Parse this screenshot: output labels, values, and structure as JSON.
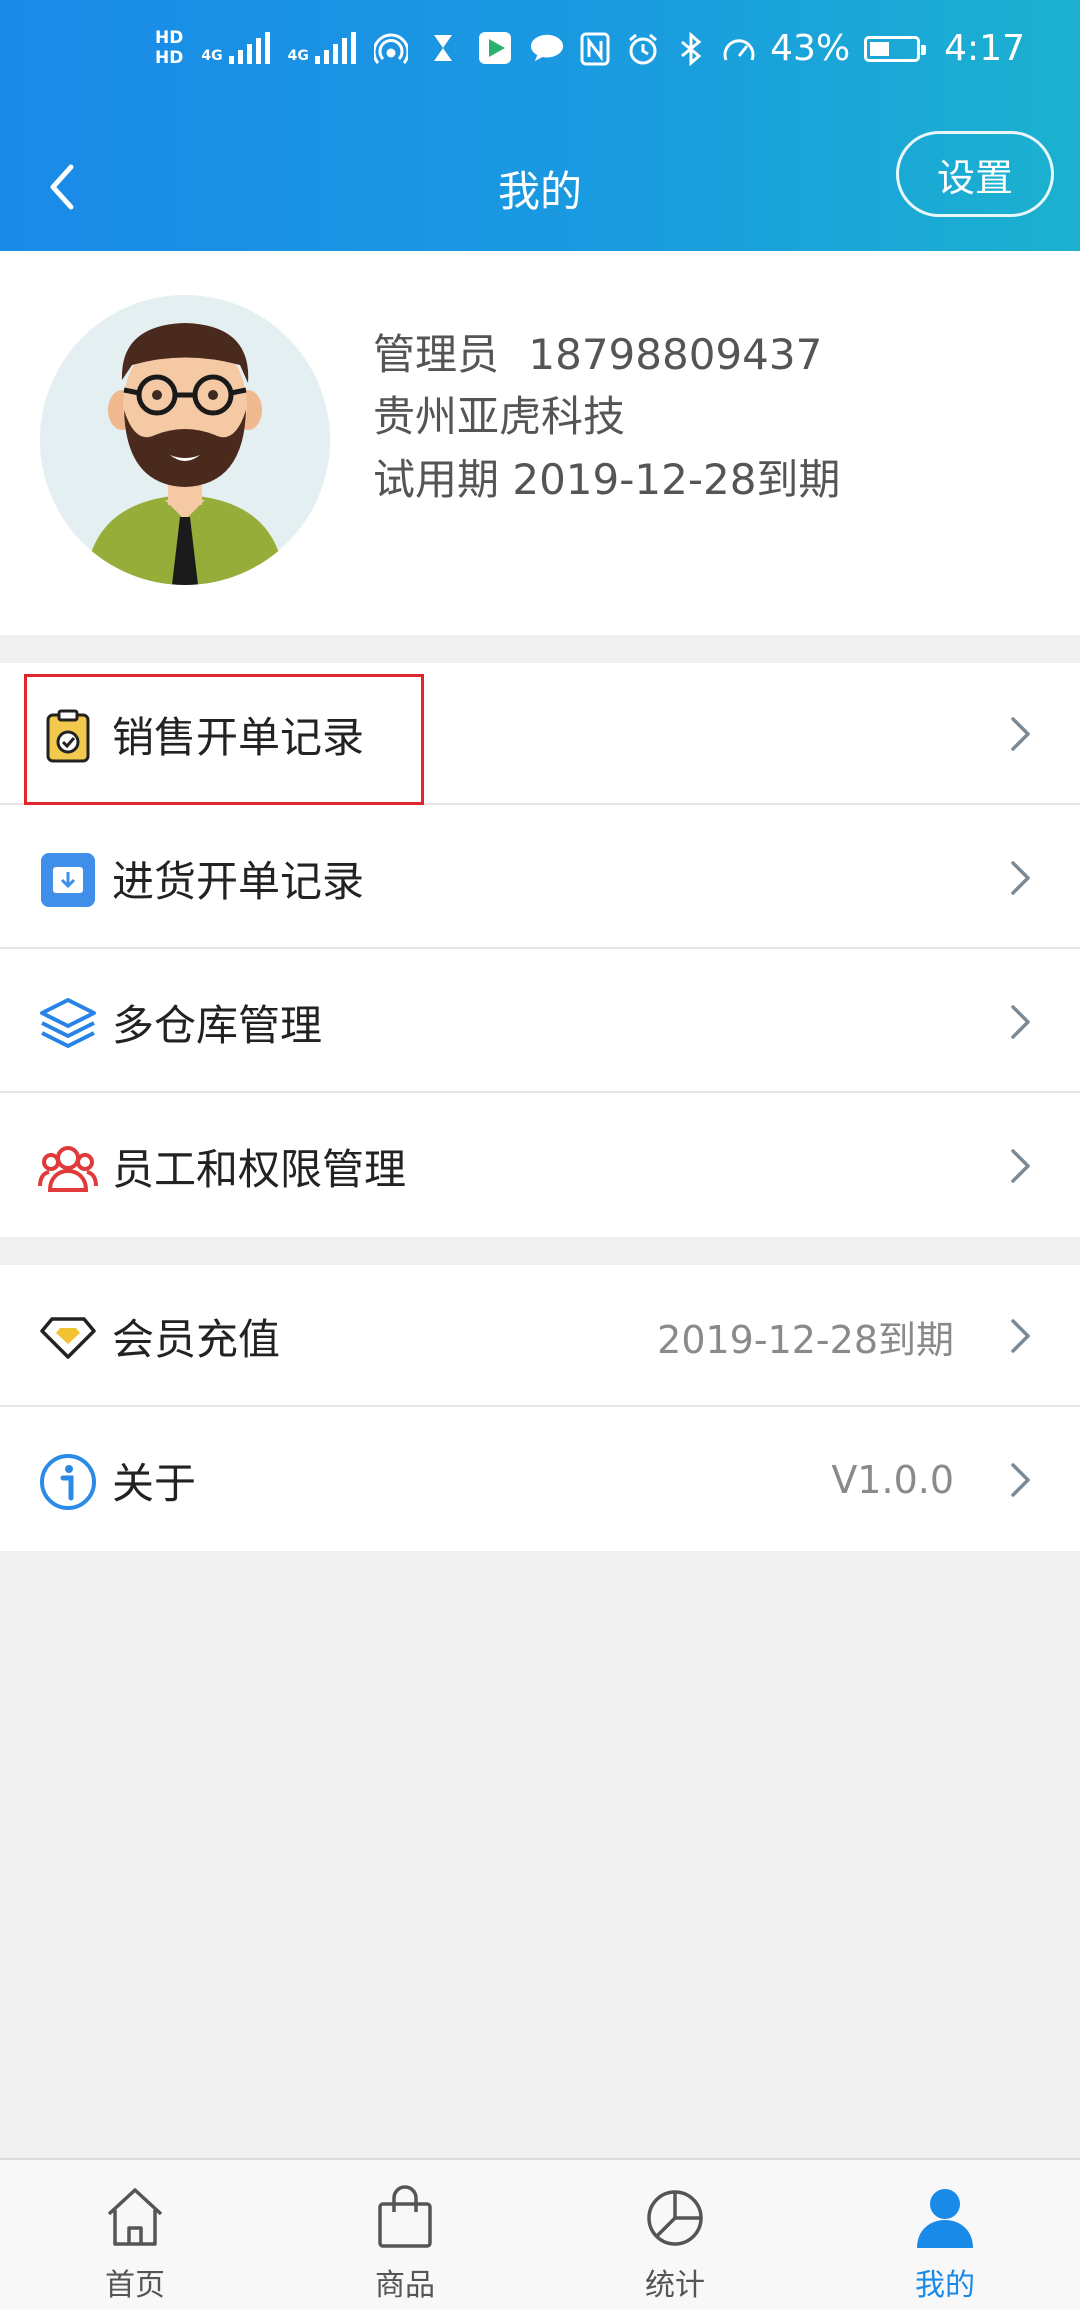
{
  "status_bar": {
    "hd1": "HD",
    "hd2": "HD",
    "net1": "4G",
    "net2": "4G",
    "battery_pct": "43%",
    "battery_level": 0.43,
    "time": "4:17",
    "icons": [
      "hotspot-icon",
      "hourglass-icon",
      "video-app-icon",
      "chat-icon",
      "nfc-icon",
      "alarm-icon",
      "bluetooth-icon",
      "speed-icon",
      "battery-icon"
    ]
  },
  "nav": {
    "title": "我的",
    "settings_label": "设置"
  },
  "profile": {
    "role": "管理员",
    "phone": "18798809437",
    "company": "贵州亚虎科技",
    "trial": "试用期 2019-12-28到期"
  },
  "menu_group1": [
    {
      "label": "销售开单记录",
      "icon": "clipboard-check-icon"
    },
    {
      "label": "进货开单记录",
      "icon": "inbox-download-icon"
    },
    {
      "label": "多仓库管理",
      "icon": "layers-icon"
    },
    {
      "label": "员工和权限管理",
      "icon": "users-icon"
    }
  ],
  "menu_group2": [
    {
      "label": "会员充值",
      "value": "2019-12-28到期",
      "icon": "diamond-icon"
    },
    {
      "label": "关于",
      "value": "V1.0.0",
      "icon": "info-icon"
    }
  ],
  "tabs": [
    {
      "label": "首页",
      "icon": "home-icon"
    },
    {
      "label": "商品",
      "icon": "shopping-bag-icon"
    },
    {
      "label": "统计",
      "icon": "pie-chart-icon"
    },
    {
      "label": "我的",
      "icon": "user-icon",
      "active": true
    }
  ],
  "colors": {
    "accent": "#1a8ae8",
    "highlight": "#e0262b"
  }
}
